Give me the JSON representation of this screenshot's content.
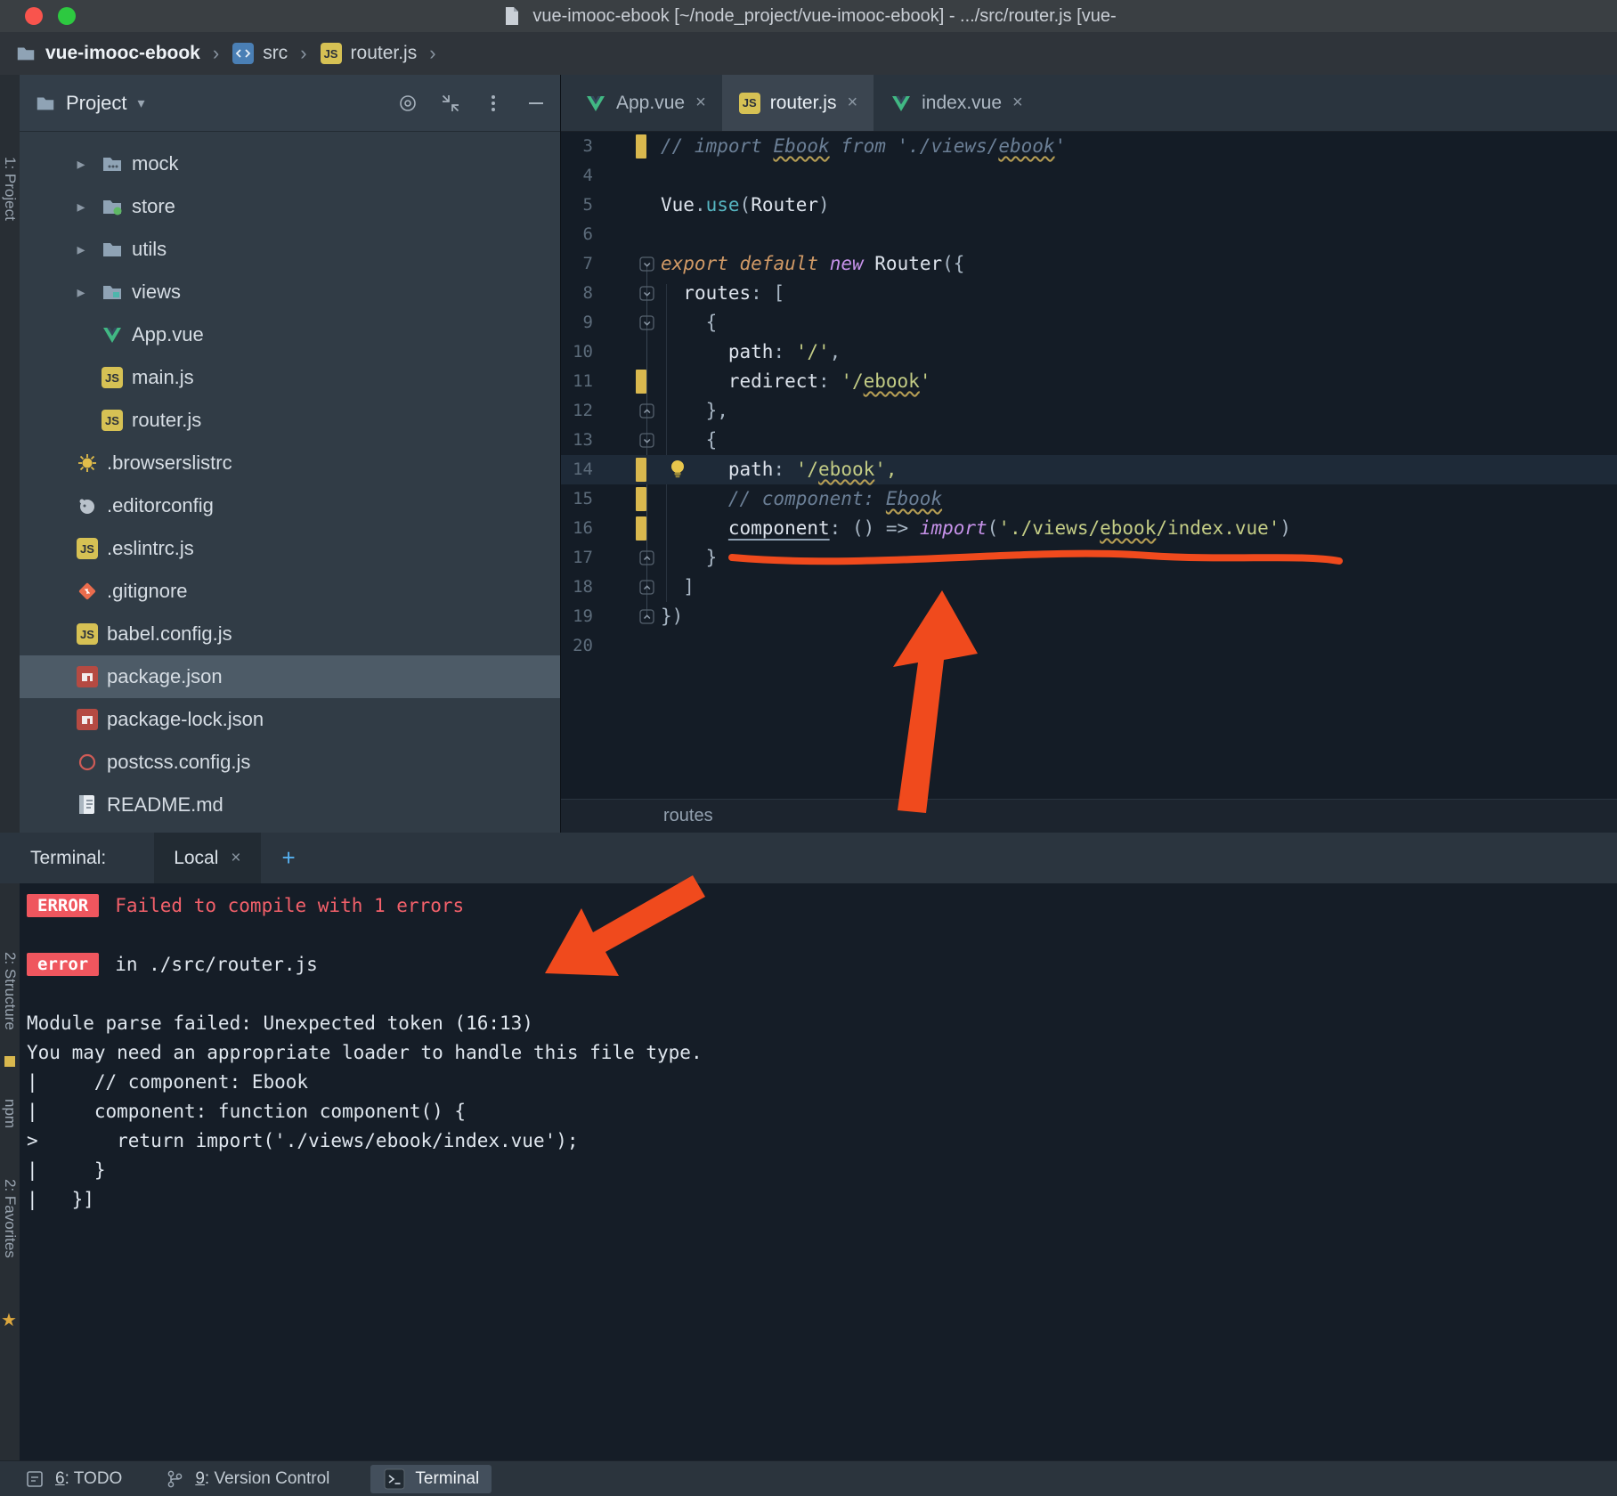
{
  "theme": {
    "annotation_orange": "#f04a1d",
    "error_badge_bg": "#ef565e",
    "error_text_red": "#f2606a",
    "change_marker_yellow": "#d9b84e",
    "selected_row_bg": "#4d5b67",
    "active_tab_bg": "#3b4550",
    "link_blue": "#56b0f0"
  },
  "window": {
    "title": "vue-imooc-ebook [~/node_project/vue-imooc-ebook] - .../src/router.js [vue-"
  },
  "breadcrumbs": {
    "items": [
      {
        "label": "vue-imooc-ebook",
        "icon": "folder-root"
      },
      {
        "label": "src",
        "icon": "src"
      },
      {
        "label": "router.js",
        "icon": "js"
      }
    ]
  },
  "left_strip": {
    "items": [
      {
        "label": "1: Project"
      },
      {
        "label": "2: Structure"
      },
      {
        "label": "npm"
      },
      {
        "label": "2: Favorites"
      }
    ]
  },
  "project_panel": {
    "title": "Project",
    "items": [
      {
        "label": "mock",
        "icon": "folder-mock",
        "chevron": true,
        "indent": 1
      },
      {
        "label": "store",
        "icon": "folder-store",
        "chevron": true,
        "indent": 1
      },
      {
        "label": "utils",
        "icon": "folder",
        "chevron": true,
        "indent": 1
      },
      {
        "label": "views",
        "icon": "folder-views",
        "chevron": true,
        "indent": 1
      },
      {
        "label": "App.vue",
        "icon": "vue",
        "indent": 1
      },
      {
        "label": "main.js",
        "icon": "js",
        "indent": 1
      },
      {
        "label": "router.js",
        "icon": "js",
        "indent": 1
      },
      {
        "label": ".browserslistrc",
        "icon": "browserslist",
        "indent": 0
      },
      {
        "label": ".editorconfig",
        "icon": "editorconfig",
        "indent": 0
      },
      {
        "label": ".eslintrc.js",
        "icon": "js",
        "indent": 0
      },
      {
        "label": ".gitignore",
        "icon": "git",
        "indent": 0
      },
      {
        "label": "babel.config.js",
        "icon": "js",
        "indent": 0
      },
      {
        "label": "package.json",
        "icon": "npm",
        "indent": 0,
        "selected": true
      },
      {
        "label": "package-lock.json",
        "icon": "npm",
        "indent": 0
      },
      {
        "label": "postcss.config.js",
        "icon": "postcss",
        "indent": 0
      },
      {
        "label": "README.md",
        "icon": "readme",
        "indent": 0
      }
    ]
  },
  "editor": {
    "tabs": [
      {
        "label": "App.vue",
        "icon": "vue"
      },
      {
        "label": "router.js",
        "icon": "js",
        "active": true
      },
      {
        "label": "index.vue",
        "icon": "vue"
      }
    ],
    "breadcrumb": "routes",
    "lines": [
      {
        "n": 3,
        "change": true,
        "tokens": [
          {
            "t": "// import ",
            "c": "cmt"
          },
          {
            "t": "Ebook",
            "c": "cmt sq"
          },
          {
            "t": " from ",
            "c": "cmt"
          },
          {
            "t": "'./views/",
            "c": "cmt"
          },
          {
            "t": "ebook",
            "c": "cmt sq"
          },
          {
            "t": "'",
            "c": "cmt"
          }
        ]
      },
      {
        "n": 4,
        "tokens": []
      },
      {
        "n": 5,
        "tokens": [
          {
            "t": "Vue",
            "c": "id"
          },
          {
            "t": ".",
            "c": "pn"
          },
          {
            "t": "use",
            "c": "fn"
          },
          {
            "t": "(",
            "c": "pn"
          },
          {
            "t": "Router",
            "c": "id"
          },
          {
            "t": ")",
            "c": "pn"
          }
        ]
      },
      {
        "n": 6,
        "tokens": []
      },
      {
        "n": 7,
        "fold": "open",
        "tokens": [
          {
            "t": "export",
            "c": "kw"
          },
          {
            "t": " ",
            "c": "pn"
          },
          {
            "t": "default",
            "c": "kw"
          },
          {
            "t": " ",
            "c": "pn"
          },
          {
            "t": "new",
            "c": "kw2"
          },
          {
            "t": " ",
            "c": "pn"
          },
          {
            "t": "Router",
            "c": "id"
          },
          {
            "t": "({",
            "c": "pn"
          }
        ]
      },
      {
        "n": 8,
        "fold": "open",
        "tokens": [
          {
            "t": "  ",
            "c": "pn"
          },
          {
            "t": "routes",
            "c": "id"
          },
          {
            "t": ": [",
            "c": "pn"
          }
        ]
      },
      {
        "n": 9,
        "fold": "open",
        "tokens": [
          {
            "t": "    {",
            "c": "pn"
          }
        ]
      },
      {
        "n": 10,
        "tokens": [
          {
            "t": "      ",
            "c": "pn"
          },
          {
            "t": "path",
            "c": "id"
          },
          {
            "t": ": ",
            "c": "pn"
          },
          {
            "t": "'/'",
            "c": "str"
          },
          {
            "t": ",",
            "c": "pn"
          }
        ]
      },
      {
        "n": 11,
        "change": true,
        "tokens": [
          {
            "t": "      ",
            "c": "pn"
          },
          {
            "t": "redirect",
            "c": "id"
          },
          {
            "t": ": ",
            "c": "pn"
          },
          {
            "t": "'/",
            "c": "str"
          },
          {
            "t": "ebook",
            "c": "str sq"
          },
          {
            "t": "'",
            "c": "str"
          }
        ]
      },
      {
        "n": 12,
        "fold": "close",
        "tokens": [
          {
            "t": "    },",
            "c": "pn"
          }
        ]
      },
      {
        "n": 13,
        "fold": "open",
        "tokens": [
          {
            "t": "    {",
            "c": "pn"
          }
        ]
      },
      {
        "n": 14,
        "current": true,
        "change": true,
        "bulb": true,
        "tokens": [
          {
            "t": "      ",
            "c": "pn"
          },
          {
            "t": "path",
            "c": "id"
          },
          {
            "t": ": ",
            "c": "pn"
          },
          {
            "t": "'/",
            "c": "str"
          },
          {
            "t": "ebook",
            "c": "str sq"
          },
          {
            "t": "',",
            "c": "str"
          }
        ]
      },
      {
        "n": 15,
        "change": true,
        "tokens": [
          {
            "t": "      ",
            "c": "pn"
          },
          {
            "t": "// component: ",
            "c": "cmt"
          },
          {
            "t": "Ebook",
            "c": "cmt sq"
          }
        ]
      },
      {
        "n": 16,
        "change": true,
        "tokens": [
          {
            "t": "      ",
            "c": "pn"
          },
          {
            "t": "component",
            "c": "id us"
          },
          {
            "t": ": () ",
            "c": "pn"
          },
          {
            "t": "=> ",
            "c": "pn"
          },
          {
            "t": "import",
            "c": "kw2"
          },
          {
            "t": "(",
            "c": "pn"
          },
          {
            "t": "'./views/",
            "c": "str"
          },
          {
            "t": "ebook",
            "c": "str sq"
          },
          {
            "t": "/index.vue'",
            "c": "str"
          },
          {
            "t": ")",
            "c": "pn"
          }
        ]
      },
      {
        "n": 17,
        "fold": "close",
        "tokens": [
          {
            "t": "    }",
            "c": "pn"
          }
        ]
      },
      {
        "n": 18,
        "fold": "close",
        "tokens": [
          {
            "t": "  ]",
            "c": "pn"
          }
        ]
      },
      {
        "n": 19,
        "fold": "close",
        "tokens": [
          {
            "t": "})",
            "c": "pn"
          }
        ]
      },
      {
        "n": 20,
        "tokens": []
      }
    ]
  },
  "terminal": {
    "label": "Terminal:",
    "tab": {
      "label": "Local"
    },
    "add_label": "+",
    "lines": [
      {
        "badge": "ERROR",
        "text": "Failed to compile with 1 errors",
        "cls": "red"
      },
      {
        "text": ""
      },
      {
        "badge": "error",
        "text": "in ./src/router.js"
      },
      {
        "text": ""
      },
      {
        "text": "Module parse failed: Unexpected token (16:13)"
      },
      {
        "text": "You may need an appropriate loader to handle this file type."
      },
      {
        "text": "|     // component: Ebook"
      },
      {
        "text": "|     component: function component() {"
      },
      {
        "text": ">       return import('./views/ebook/index.vue');"
      },
      {
        "text": "|     }"
      },
      {
        "text": "|   }]"
      }
    ]
  },
  "status": {
    "todo": {
      "key": "6",
      "label": ": TODO"
    },
    "version_control": {
      "key": "9",
      "label": ": Version Control"
    },
    "terminal": {
      "label": "Terminal"
    }
  }
}
